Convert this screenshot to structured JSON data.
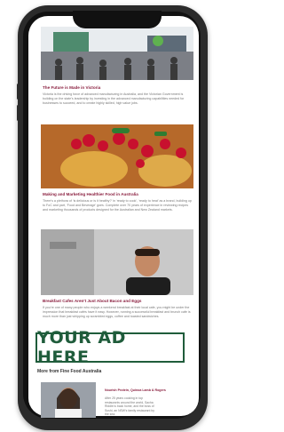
{
  "articles": [
    {
      "headline": "The Future is Made in Victoria",
      "body": "Victoria is the driving force of advanced manufacturing in Australia, and the Victorian Government is building on the state’s leadership by investing in the advanced manufacturing capabilities needed for businesses to succeed, and to create highly skilled, high value jobs."
    },
    {
      "headline": "Making and Marketing Healthier Food in Australia",
      "body": "There’s a plethora of ‘is delicious or is it healthy?’ in ‘ready to cook’, ‘ready to heat’ as a brand, building up to FoC and part, ‘Food and Beverage’ goes. Complete over 70 years of experience in reviewing recipes and marketing thousands of products designed for the Australian and New Zealand markets."
    },
    {
      "headline": "Breakfast Cafes Aren’t Just About Bacon and Eggs",
      "body": "If you’re one of many people who enjoys a weekend breakfast at their local cafe, you might be under the impression that breakfast cafés have it easy. However, running a successful breakfast and brunch cafe is much more than just whipping up scrambled eggs, coffee and toasted sandwiches."
    }
  ],
  "ad": {
    "text": "YOUR AD HERE"
  },
  "section": {
    "title": "More from Fine Food Australia"
  },
  "card": {
    "title": "Nourish Protein, Quinoa Lamb & Rogers",
    "text": "After 25 years cooking in top restaurants around the world, Sacha Riddle is back home, and the boss of Sushi, an NSW’s family restaurant by the sea."
  },
  "colors": {
    "accent": "#8a1f3f",
    "ad_green": "#1f5c3b",
    "phone": "#2b2b2b"
  }
}
